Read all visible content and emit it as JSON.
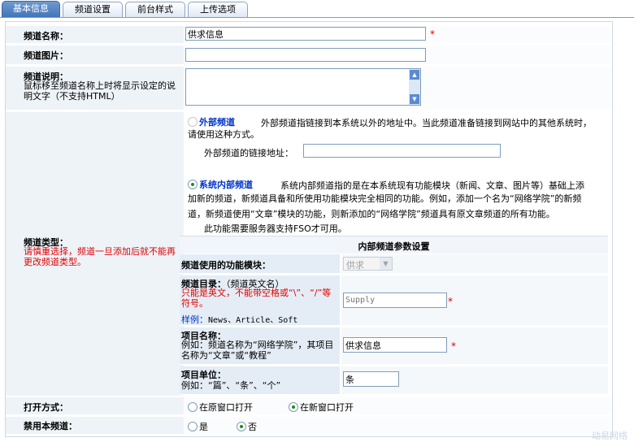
{
  "tabs": [
    "基本信息",
    "频道设置",
    "前台样式",
    "上传选项"
  ],
  "channel_name": {
    "label": "频道名称：",
    "value": "供求信息"
  },
  "channel_image": {
    "label": "频道图片："
  },
  "channel_desc": {
    "label": "频道说明：",
    "hint": "鼠标移至频道名称上时将显示设定的说明文字（不支持HTML）"
  },
  "channel_type": {
    "label": "频道类型：",
    "warning": "请慎重选择，频道一旦添加后就不能再更改频道类型。",
    "external_option": "外部频道",
    "external_desc_1": "外部频道指链接到本系统以外的地址中。当此频道准备链接到网站中的其他系统时，",
    "external_desc_2": "请使用这种方式。",
    "external_link_label": "外部频道的链接地址：",
    "internal_option": "系统内部频道",
    "internal_desc_1": "系统内部频道指的是在本系统现有功能模块（新闻、文章、图片等）基础上添",
    "internal_desc_2": "加新的频道，新频道具备和所使用功能模块完全相同的功能。例如，添加一个名为“网络学院”的新频",
    "internal_desc_3": "道，新频道使用“文章”模块的功能，则新添加的“网络学院”频道具有原文章频道的所有功能。",
    "fso_note": "此功能需要服务器支持FSO才可用。",
    "internal_params_title": "内部频道参数设置",
    "module_label": "频道使用的功能模块：",
    "module_value": "供求",
    "dir_label": "频道目录：",
    "dir_label_sub": "（频道英文名）",
    "dir_warn": "只能是英文，不能带空格或“\\”、“/”等符号。",
    "dir_example_label": "样例：",
    "dir_example": "News、Article、Soft",
    "dir_placeholder": "Supply",
    "item_name_label": "项目名称：",
    "item_name_hint": "例如：频道名称为“网络学院”，其项目名称为“文章”或“教程”",
    "item_name_value": "供求信息",
    "item_unit_label": "项目单位：",
    "item_unit_hint": "例如：“篇”、“条”、“个”",
    "item_unit_value": "条"
  },
  "open_mode": {
    "label": "打开方式：",
    "option_1": "在原窗口打开",
    "option_2": "在新窗口打开"
  },
  "disable_channel": {
    "label": "禁用本频道：",
    "yes": "是",
    "no": "否"
  },
  "watermark": "动易网络"
}
